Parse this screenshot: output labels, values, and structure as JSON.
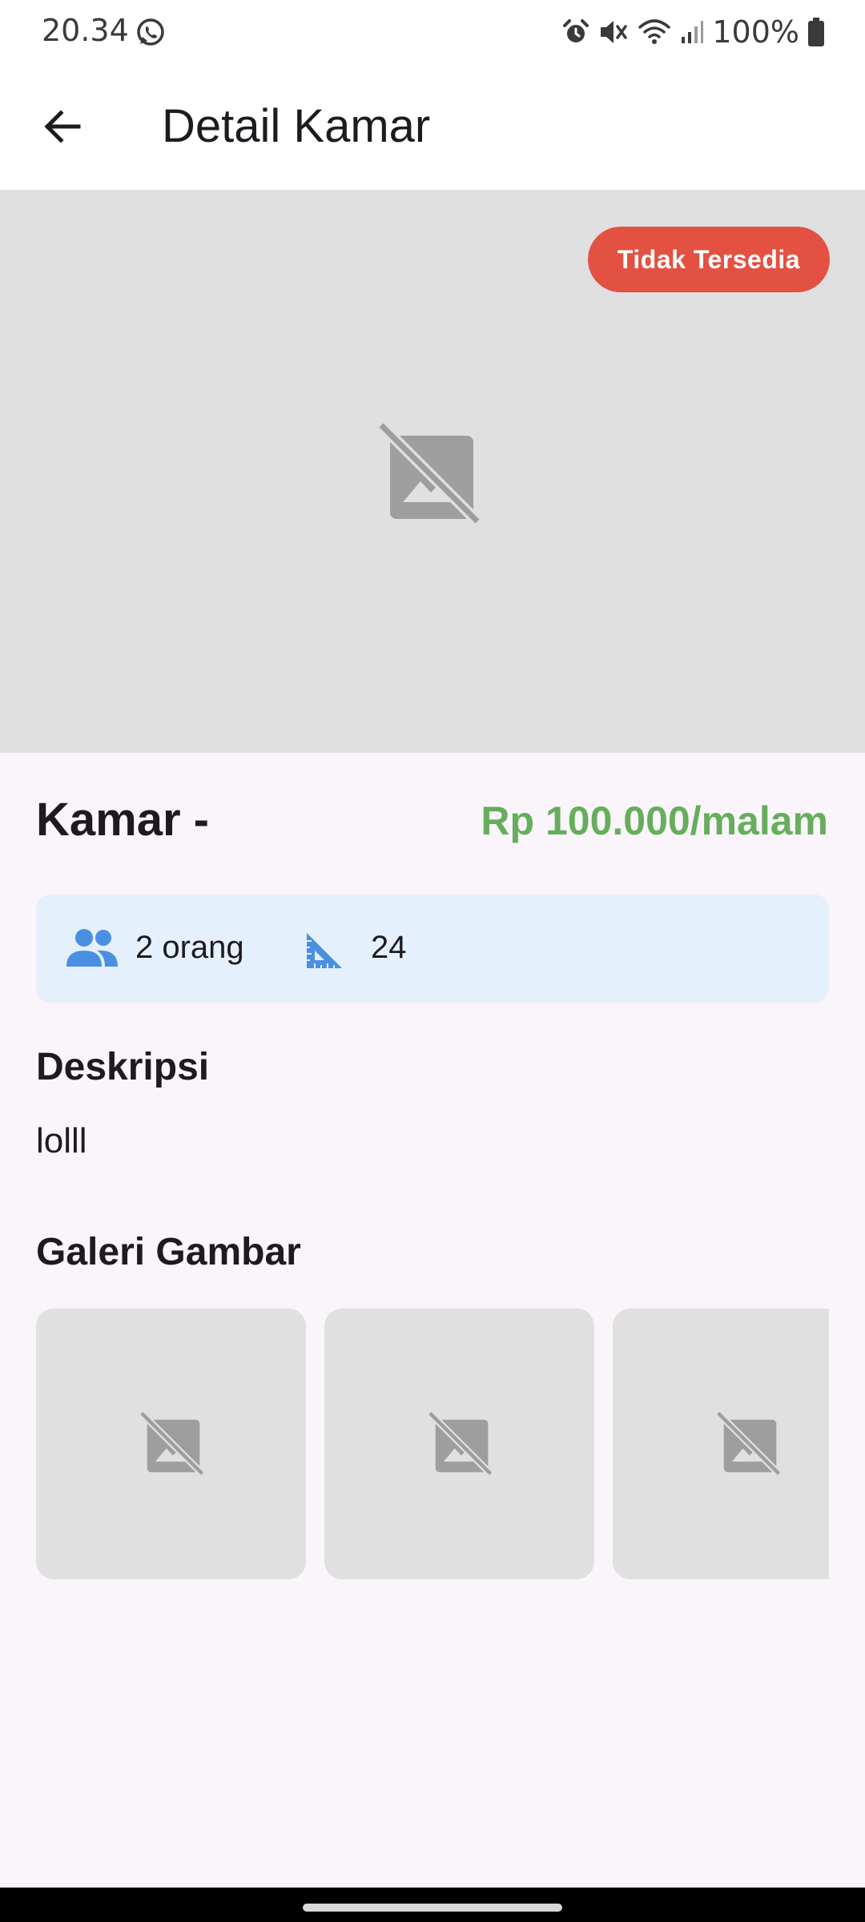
{
  "status_bar": {
    "time": "20.34",
    "battery": "100%",
    "icons": [
      "whatsapp-icon",
      "alarm-icon",
      "mute-icon",
      "wifi-icon",
      "signal-icon",
      "battery-icon"
    ]
  },
  "app_bar": {
    "title": "Detail Kamar",
    "back_icon": "arrow-back-icon"
  },
  "hero": {
    "status_badge": "Tidak Tersedia",
    "placeholder_icon": "image-not-supported-icon",
    "badge_color": "#e35142"
  },
  "room": {
    "name": "Kamar -",
    "price": "Rp 100.000/malam",
    "price_color": "#66ae5c",
    "capacity": "2 orang",
    "size": "24"
  },
  "description": {
    "title": "Deskripsi",
    "text": "lolll"
  },
  "gallery": {
    "title": "Galeri Gambar",
    "items": [
      {
        "icon": "image-not-supported-icon"
      },
      {
        "icon": "image-not-supported-icon"
      },
      {
        "icon": "image-not-supported-icon"
      }
    ]
  },
  "colors": {
    "accent_blue": "#4a90e2",
    "info_card_bg": "#e4f0fb",
    "page_bg": "#faf5fa",
    "placeholder_bg": "#e0e0e0"
  }
}
